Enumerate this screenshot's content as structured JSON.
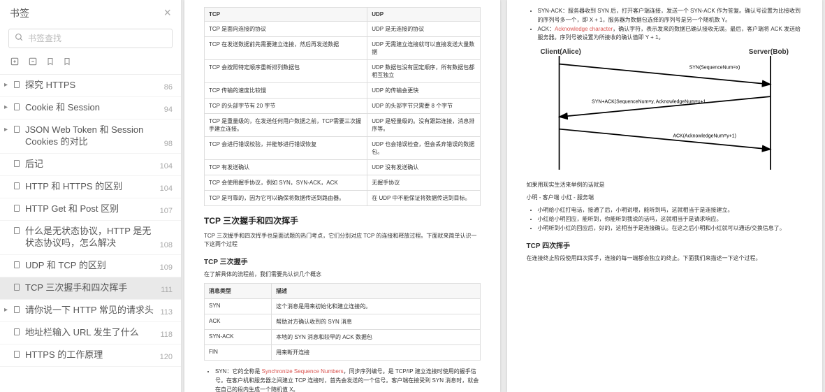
{
  "sidebar": {
    "title": "书签",
    "search_placeholder": "书签查找",
    "items": [
      {
        "arrow": "▸",
        "label": "探究 HTTPS",
        "page": "86"
      },
      {
        "arrow": "▸",
        "label": "Cookie 和 Session",
        "page": "94"
      },
      {
        "arrow": "▸",
        "label": "JSON Web Token 和 Session Cookies 的对比",
        "page": "98"
      },
      {
        "arrow": "",
        "label": "后记",
        "page": "104"
      },
      {
        "arrow": "",
        "label": "HTTP 和 HTTPS 的区别",
        "page": "104"
      },
      {
        "arrow": "",
        "label": "HTTP Get 和 Post 区别",
        "page": "107"
      },
      {
        "arrow": "",
        "label": "什么是无状态协议，HTTP 是无状态协议吗，怎么解决",
        "page": "108"
      },
      {
        "arrow": "",
        "label": "UDP 和 TCP 的区别",
        "page": "109"
      },
      {
        "arrow": "",
        "label": "TCP 三次握手和四次挥手",
        "page": "111",
        "selected": true
      },
      {
        "arrow": "▸",
        "label": "请你说一下 HTTP 常见的请求头",
        "page": "113"
      },
      {
        "arrow": "",
        "label": "地址栏输入 URL 发生了什么",
        "page": "118"
      },
      {
        "arrow": "",
        "label": "HTTPS 的工作原理",
        "page": "120"
      }
    ]
  },
  "page1": {
    "table1": {
      "headers": [
        "TCP",
        "UDP"
      ],
      "rows": [
        [
          "TCP 是面向连接的协议",
          "UDP 是无连接的协议"
        ],
        [
          "TCP 在发送数据前先需要建立连接，然后再发送数据",
          "UDP 无需建立连接就可以直接发送大量数据"
        ],
        [
          "TCP 会按照特定顺序重新排列数据包",
          "UDP 数据包没有固定顺序，所有数据包都相互独立"
        ],
        [
          "TCP 传输的速度比较慢",
          "UDP 的传输会更快"
        ],
        [
          "TCP 的头部字节有 20 字节",
          "UDP 的头部字节只需要 8 个字节"
        ],
        [
          "TCP 是重量级的，在发送任何用户数据之前，TCP需要三次握手建立连接。",
          "UDP 是轻量级的。没有跟踪连接，消息排序等。"
        ],
        [
          "TCP 会进行错误校验，并能够进行错误恢复",
          "UDP 也会错误检查，但会丢弃错误的数据包。"
        ],
        [
          "TCP 有发送确认",
          "UDP 没有发送确认"
        ],
        [
          "TCP 会使用握手协议，例如 SYN，SYN-ACK，ACK",
          "无握手协议"
        ],
        [
          "TCP 是可靠的，因为它可以确保将数据传送到路由器。",
          "在 UDP 中不能保证将数据传送到目标。"
        ]
      ]
    },
    "h2_1": "TCP 三次握手和四次挥手",
    "p1": "TCP 三次握手和四次挥手也是面试题的热门考点，它们分别对应 TCP 的连接和释放过程。下面就来简单认识一下这两个过程",
    "h3_1": "TCP 三次握手",
    "p2": "在了解具体的流程前，我们需要先认识几个概念",
    "table2": {
      "headers": [
        "消息类型",
        "描述"
      ],
      "rows": [
        [
          "SYN",
          "这个消息是用来初始化和建立连接的。"
        ],
        [
          "ACK",
          "帮助对方确认收到的 SYN 消息"
        ],
        [
          "SYN-ACK",
          "本地的 SYN 消息和较早的 ACK 数据包"
        ],
        [
          "FIN",
          "用来断开连接"
        ]
      ]
    },
    "bullet1_prefix": "SYN：它的全称是 ",
    "bullet1_highlight": "Synchronize Sequence Numbers",
    "bullet1_suffix": "，同步序列编号。是 TCP/IP 建立连接时使用的握手信号。在客户机和服务器之间建立 TCP 连接时，首先会发送的一个信号。客户端在接受到 SYN 消息时，就会在自己的段内生成一个随机值 X。"
  },
  "page2": {
    "bullet_synack_prefix": "SYN-ACK：服务器收到 SYN 后，打开客户端连接，发送一个 SYN-ACK 作为答复。确认号设置为比接收到的序列号多一个，即 X + 1，服务器为数据包选择的序列号是另一个随机数 Y。",
    "bullet_ack_prefix": "ACK：",
    "bullet_ack_highlight": "Acknowledge character",
    "bullet_ack_suffix": "，确认字符，表示发来的数据已确认接收无误。最后，客户端将 ACK 发送给服务器。序列号被设置为所接收的确认值即 Y + 1。",
    "diagram": {
      "client": "Client(Alice)",
      "server": "Server(Bob)",
      "msg1": "SYN(SequenceNum=x)",
      "msg2": "SYN+ACK(SequenceNum=y, AcknowledgeNum=x+1",
      "msg3": "ACK(AcknowledgeNum=y+1)"
    },
    "p_example": "如果用现实生活来举例的话就是",
    "p_roles": "小明 - 客户端 小红 - 服务端",
    "bullets": [
      "小明给小红打电话，接通了后，小明说喂，能听到吗，这就相当于是连接建立。",
      "小红给小明回应，能听到，你能听到我说的话吗，这就相当于是请求响应。",
      "小明听到小红的回应后，好的，这相当于是连接确认。在这之后小明和小红就可以通话/交换信息了。"
    ],
    "h3_2": "TCP 四次挥手",
    "p3": "在连接终止阶段使用四次挥手，连接的每一端都会独立的终止。下面我们来描述一下这个过程。"
  }
}
